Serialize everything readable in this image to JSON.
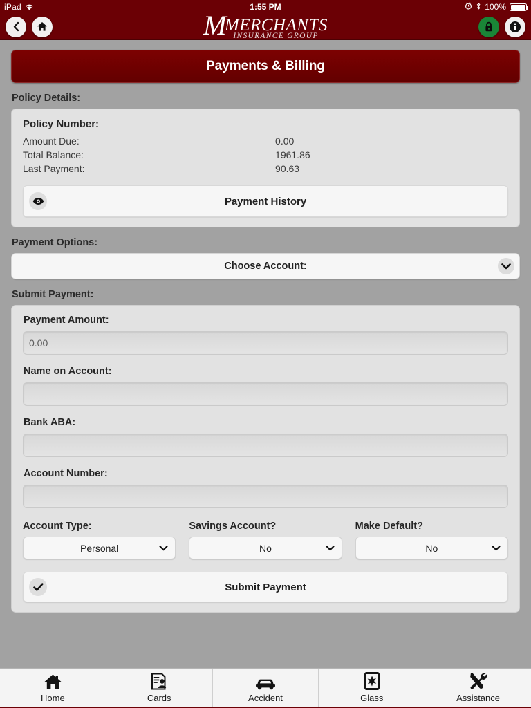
{
  "status_bar": {
    "device": "iPad",
    "wifi_icon": "wifi-icon",
    "time": "1:55 PM",
    "alarm_icon": "alarm-clock-icon",
    "bluetooth_icon": "bluetooth-icon",
    "battery_percent": "100%",
    "battery_icon": "battery-full-icon"
  },
  "navbar": {
    "back_icon": "chevron-left-icon",
    "home_icon": "home-icon",
    "lock_icon": "lock-icon",
    "info_icon": "info-icon",
    "brand_initial": "M",
    "brand_name": "MERCHANTS",
    "brand_tagline": "INSURANCE GROUP",
    "lock_color": "#1a8537"
  },
  "page": {
    "title": "Payments & Billing",
    "title_bar_color": "#760000"
  },
  "policy_details": {
    "section_label": "Policy Details:",
    "policy_number_label": "Policy Number:",
    "policy_number_value": "",
    "rows": [
      {
        "key": "Amount Due:",
        "value": "0.00"
      },
      {
        "key": "Total Balance:",
        "value": "1961.86"
      },
      {
        "key": "Last Payment:",
        "value": "90.63"
      }
    ],
    "payment_history_label": "Payment History",
    "payment_history_icon": "eye-icon"
  },
  "payment_options": {
    "section_label": "Payment Options:",
    "choose_account_label": "Choose Account:",
    "chevron_icon": "chevron-down-icon"
  },
  "submit_payment": {
    "section_label": "Submit Payment:",
    "payment_amount_label": "Payment Amount:",
    "payment_amount_value": "0.00",
    "name_on_account_label": "Name on Account:",
    "name_on_account_value": "",
    "bank_aba_label": "Bank ABA:",
    "bank_aba_value": "",
    "account_number_label": "Account Number:",
    "account_number_value": "",
    "selects": [
      {
        "label": "Account Type:",
        "value": "Personal",
        "icon": "chevron-down-icon"
      },
      {
        "label": "Savings Account?",
        "value": "No",
        "icon": "chevron-down-icon"
      },
      {
        "label": "Make Default?",
        "value": "No",
        "icon": "chevron-down-icon"
      }
    ],
    "submit_button_label": "Submit Payment",
    "submit_button_icon": "checkmark-icon"
  },
  "tabbar": {
    "tabs": [
      {
        "label": "Home",
        "icon": "home-icon"
      },
      {
        "label": "Cards",
        "icon": "id-card-icon"
      },
      {
        "label": "Accident",
        "icon": "car-icon"
      },
      {
        "label": "Glass",
        "icon": "broken-window-icon"
      },
      {
        "label": "Assistance",
        "icon": "tools-icon"
      }
    ]
  }
}
